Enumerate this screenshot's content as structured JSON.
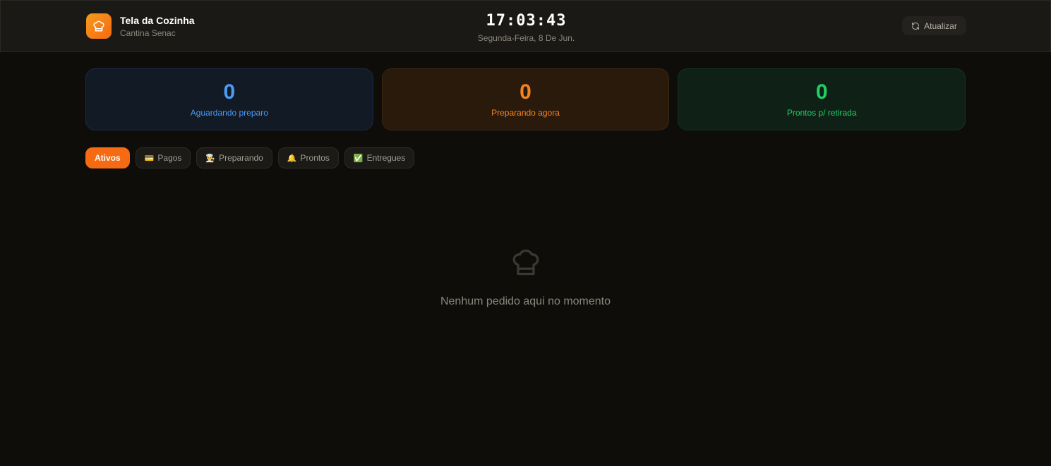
{
  "header": {
    "title": "Tela da Cozinha",
    "subtitle": "Cantina Senac",
    "clock": "17:03:43",
    "date": "Segunda-Feira, 8 De Jun.",
    "refresh_label": "Atualizar"
  },
  "stats": [
    {
      "value": "0",
      "label": "Aguardando preparo",
      "color": "#4a9cf7"
    },
    {
      "value": "0",
      "label": "Preparando agora",
      "color": "#f5841f"
    },
    {
      "value": "0",
      "label": "Prontos p/ retirada",
      "color": "#1fd165"
    }
  ],
  "filters": [
    {
      "label": "Ativos",
      "icon": ""
    },
    {
      "label": "Pagos",
      "icon": "credit-card-icon"
    },
    {
      "label": "Preparando",
      "icon": "cook-icon"
    },
    {
      "label": "Prontos",
      "icon": "bell-icon"
    },
    {
      "label": "Entregues",
      "icon": "check-box-icon"
    }
  ],
  "empty_state": {
    "icon": "chef-hat-icon",
    "message": "Nenhum pedido aqui no momento"
  },
  "colors": {
    "accent": "#f56a12",
    "background": "#0e0d0a"
  }
}
